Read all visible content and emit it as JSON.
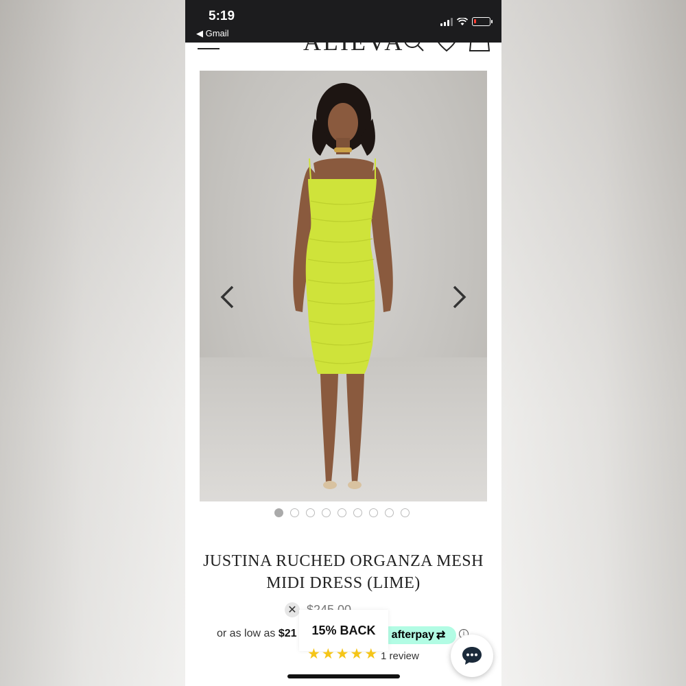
{
  "status_bar": {
    "time": "5:19",
    "back_app": "◀ Gmail",
    "battery_color": "#ff3b30"
  },
  "header": {
    "logo": "ALIEVA",
    "icons": [
      "menu-icon",
      "search-icon",
      "heart-icon",
      "bag-icon"
    ]
  },
  "gallery": {
    "dot_count": 9,
    "active_index": 0,
    "dress_color": "#cfe33a"
  },
  "product": {
    "title": "JUSTINA RUCHED ORGANZA MESH MIDI DRESS (LIME)",
    "price": "$245.00",
    "installment_prefix": "or as low as",
    "installment_amount": "$21",
    "afterpay_label": "afterpay",
    "afterpay_color": "#b2fce4",
    "rating": 5,
    "review_count": "1 review"
  },
  "promo": {
    "label": "15% BACK"
  }
}
